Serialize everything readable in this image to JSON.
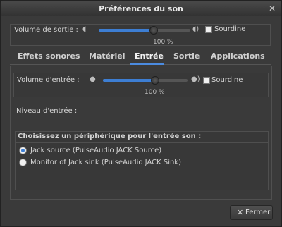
{
  "window": {
    "title": "Préférences du son"
  },
  "output": {
    "label": "Volume de sortie :",
    "value_percent": 60,
    "percent_text": "100 %",
    "mute_label": "Sourdine",
    "muted": false
  },
  "tabs": [
    {
      "label": "Effets sonores",
      "active": false
    },
    {
      "label": "Matériel",
      "active": false
    },
    {
      "label": "Entrée",
      "active": true
    },
    {
      "label": "Sortie",
      "active": false
    },
    {
      "label": "Applications",
      "active": false
    }
  ],
  "input": {
    "label": "Volume d'entrée :",
    "value_percent": 62,
    "percent_text": "100 %",
    "mute_label": "Sourdine",
    "muted": false,
    "level_label": "Niveau d'entrée :"
  },
  "devices": {
    "heading": "Choisissez un périphérique pour l'entrée son :",
    "items": [
      {
        "label": "Jack source (PulseAudio JACK Source)",
        "selected": true
      },
      {
        "label": "Monitor of Jack sink (PulseAudio JACK Sink)",
        "selected": false
      }
    ]
  },
  "buttons": {
    "close_label": "Fermer"
  },
  "colors": {
    "accent": "#3d7ed3",
    "background": "#3a3a3a"
  },
  "icons": {
    "output": "speaker-icon",
    "input": "microphone-icon",
    "close": "close-icon"
  }
}
